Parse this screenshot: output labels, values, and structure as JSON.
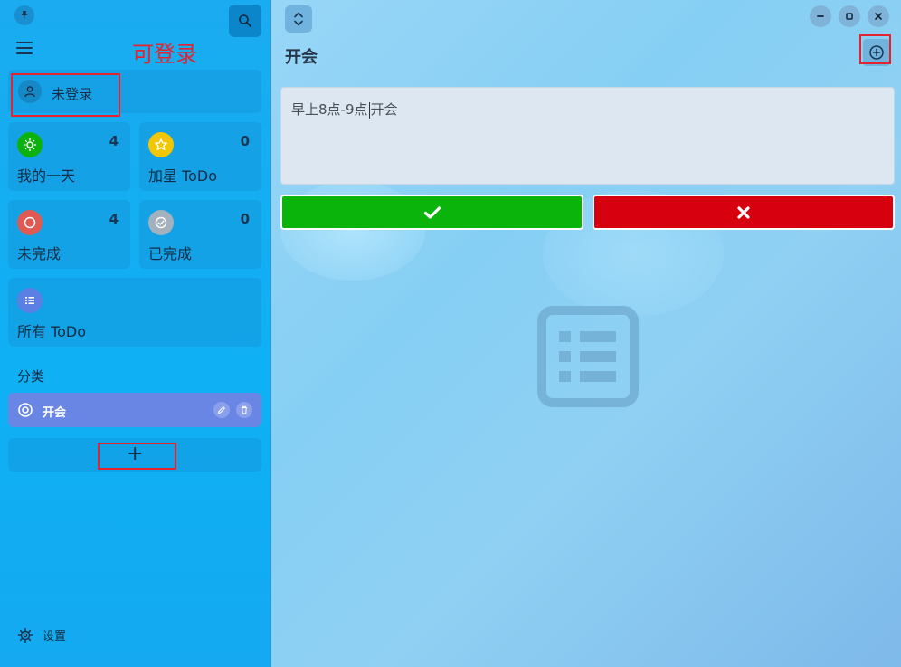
{
  "sidebar": {
    "annotation": "可登录",
    "user": {
      "label": "未登录"
    },
    "tiles": [
      {
        "label": "我的一天",
        "count": "4",
        "color": "#0db10d",
        "icon": "sun-icon"
      },
      {
        "label": "加星 ToDo",
        "count": "0",
        "color": "#f2c600",
        "icon": "star-icon"
      },
      {
        "label": "未完成",
        "count": "4",
        "color": "#e05a54",
        "icon": "circle-icon"
      },
      {
        "label": "已完成",
        "count": "0",
        "color": "#a3b0bd",
        "icon": "check-circle-icon"
      }
    ],
    "all_todo": {
      "label": "所有 ToDo",
      "color": "#5b7fe2",
      "icon": "list-icon"
    },
    "section_title": "分类",
    "categories": [
      {
        "label": "开会",
        "color": "#6a86e5",
        "icon": "target-icon"
      }
    ],
    "add_category": "+",
    "settings": {
      "label": "设置"
    }
  },
  "main": {
    "title": "开会",
    "input_value": "早上8点-9点开会",
    "input_before_caret": "早上8点-9点",
    "input_after_caret": "开会",
    "confirm_color": "#0bb40b",
    "cancel_color": "#d7000f"
  },
  "colors": {
    "accent_red_annotation": "#e5232e",
    "sidebar_bg": "#11adf2"
  }
}
